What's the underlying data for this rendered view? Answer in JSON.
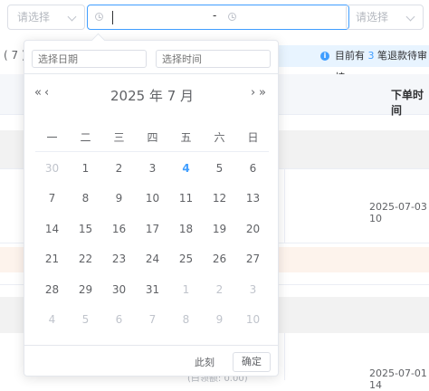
{
  "filters": {
    "left_select_placeholder": "请选择",
    "range_separator": "-",
    "right_select_placeholder": "请选择"
  },
  "table": {
    "count_text": "( 7 )",
    "notice": {
      "prefix": "目前有",
      "count": "3",
      "suffix": "笔退款待审核"
    },
    "header_col": "下单时间",
    "dates": [
      "2025-07-03 10",
      "2025-07-01 14"
    ],
    "faded_text": "(白领额: 0.00)"
  },
  "picker": {
    "date_placeholder": "选择日期",
    "time_placeholder": "选择时间",
    "prev_year": "«",
    "prev_month": "‹",
    "next_month": "›",
    "next_year": "»",
    "title": "2025 年  7 月",
    "weekdays": [
      "一",
      "二",
      "三",
      "四",
      "五",
      "六",
      "日"
    ],
    "days": [
      [
        "30",
        "1",
        "2",
        "3",
        "4",
        "5",
        "6"
      ],
      [
        "7",
        "8",
        "9",
        "10",
        "11",
        "12",
        "13"
      ],
      [
        "14",
        "15",
        "16",
        "17",
        "18",
        "19",
        "20"
      ],
      [
        "21",
        "22",
        "23",
        "24",
        "25",
        "26",
        "27"
      ],
      [
        "28",
        "29",
        "30",
        "31",
        "1",
        "2",
        "3"
      ],
      [
        "4",
        "5",
        "6",
        "7",
        "8",
        "9",
        "10"
      ]
    ],
    "now_label": "此刻",
    "ok_label": "确定",
    "accent": "#409eff"
  }
}
